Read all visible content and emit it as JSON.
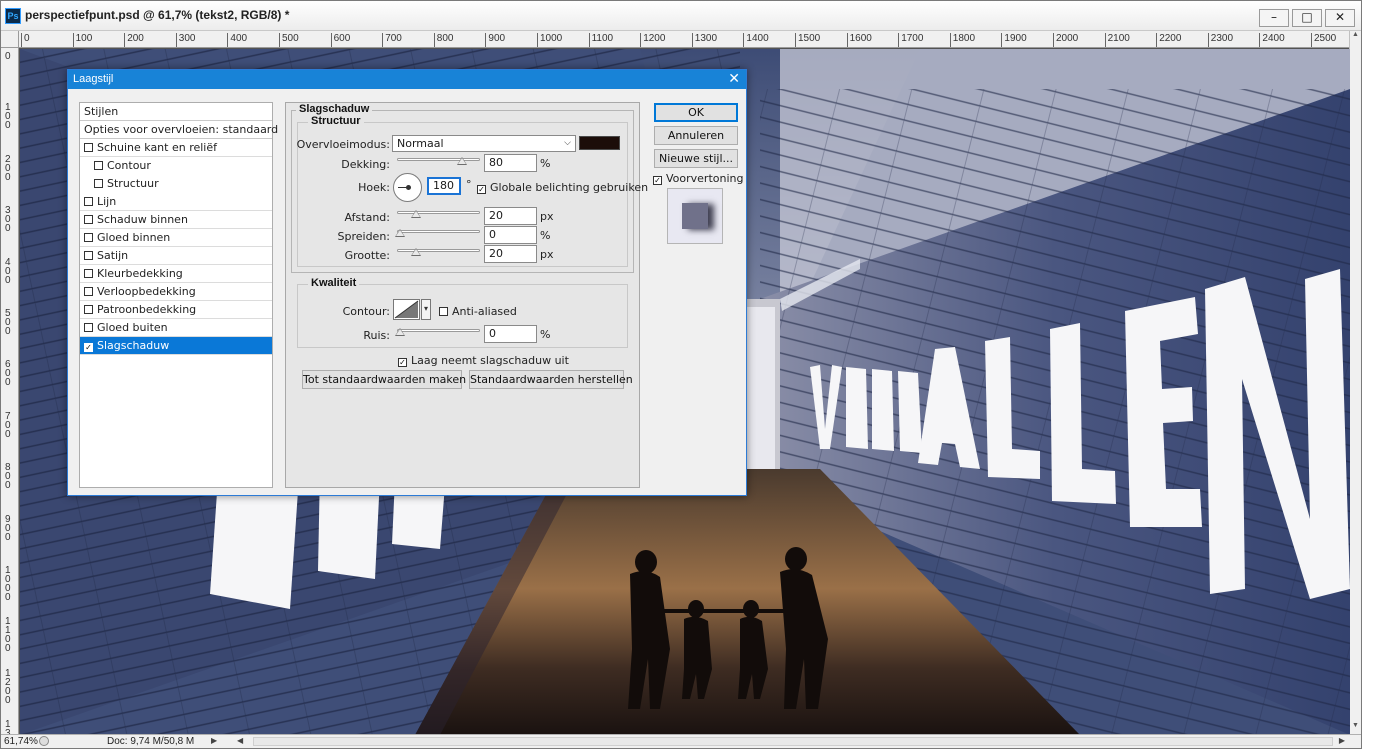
{
  "document": {
    "title": "perspectiefpunt.psd @ 61,7% (tekst2, RGB/8) *",
    "app_icon": "Ps",
    "window_controls": [
      "–",
      "□",
      "✕"
    ]
  },
  "rulers": {
    "top": [
      "0",
      "100",
      "200",
      "300",
      "400",
      "500",
      "600",
      "700",
      "800",
      "900",
      "1000",
      "1100",
      "1200",
      "1300",
      "1400",
      "1500",
      "1600",
      "1700",
      "1800",
      "1900",
      "2000",
      "2100",
      "2200",
      "2300",
      "2400",
      "2500"
    ],
    "left": [
      "0",
      "100",
      "200",
      "300",
      "400",
      "500",
      "600",
      "700",
      "800",
      "900",
      "1000",
      "1100",
      "1200",
      "1300"
    ]
  },
  "canvas": {
    "headline": "VOOR ALLEN"
  },
  "statusbar": {
    "zoom": "61,74%",
    "doc": "Doc: 9,74 M/50,8 M"
  },
  "dialog": {
    "title": "Laagstijl",
    "close_glyph": "✕",
    "styles_list": {
      "header": "Stijlen",
      "blend_options": "Opties voor overvloeien: standaard",
      "items": [
        {
          "label": "Schuine kant en reliëf",
          "checked": false,
          "sub": false,
          "selected": false
        },
        {
          "label": "Contour",
          "checked": false,
          "sub": true,
          "selected": false
        },
        {
          "label": "Structuur",
          "checked": false,
          "sub": true,
          "selected": false
        },
        {
          "label": "Lijn",
          "checked": false,
          "sub": false,
          "selected": false
        },
        {
          "label": "Schaduw binnen",
          "checked": false,
          "sub": false,
          "selected": false
        },
        {
          "label": "Gloed binnen",
          "checked": false,
          "sub": false,
          "selected": false
        },
        {
          "label": "Satijn",
          "checked": false,
          "sub": false,
          "selected": false
        },
        {
          "label": "Kleurbedekking",
          "checked": false,
          "sub": false,
          "selected": false
        },
        {
          "label": "Verloopbedekking",
          "checked": false,
          "sub": false,
          "selected": false
        },
        {
          "label": "Patroonbedekking",
          "checked": false,
          "sub": false,
          "selected": false
        },
        {
          "label": "Gloed buiten",
          "checked": false,
          "sub": false,
          "selected": false
        },
        {
          "label": "Slagschaduw",
          "checked": true,
          "sub": false,
          "selected": true
        }
      ]
    },
    "section_title": "Slagschaduw",
    "structure": {
      "title": "Structuur",
      "blend_mode_label": "Overvloeimodus:",
      "blend_mode_value": "Normaal",
      "shadow_color": "#1c0d09",
      "opacity_label": "Dekking:",
      "opacity_value": "80",
      "opacity_unit": "%",
      "angle_label": "Hoek:",
      "angle_value": "180",
      "angle_unit": "°",
      "global_light_label": "Globale belichting gebruiken",
      "global_light_checked": true,
      "distance_label": "Afstand:",
      "distance_value": "20",
      "distance_unit": "px",
      "spread_label": "Spreiden:",
      "spread_value": "0",
      "spread_unit": "%",
      "size_label": "Grootte:",
      "size_value": "20",
      "size_unit": "px"
    },
    "quality": {
      "title": "Kwaliteit",
      "contour_label": "Contour:",
      "anti_aliased_label": "Anti-aliased",
      "anti_aliased_checked": false,
      "noise_label": "Ruis:",
      "noise_value": "0",
      "noise_unit": "%"
    },
    "knockout_label": "Laag neemt slagschaduw uit",
    "knockout_checked": true,
    "make_default_label": "Tot standaardwaarden maken",
    "reset_default_label": "Standaardwaarden herstellen",
    "buttons": {
      "ok": "OK",
      "cancel": "Annuleren",
      "new_style": "Nieuwe stijl...",
      "preview_label": "Voorvertoning",
      "preview_checked": true
    }
  },
  "colors": {
    "dialog_titlebar": "#1883d7",
    "selection": "#0a78d7",
    "wood_blue": "#3f4e78"
  }
}
